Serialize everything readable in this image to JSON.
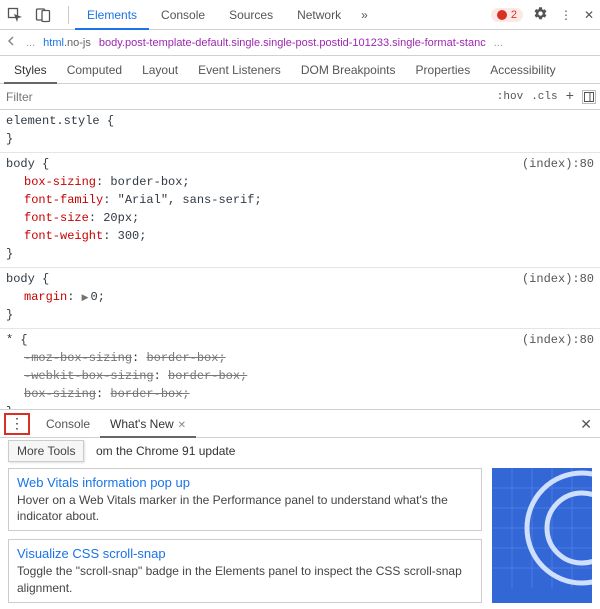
{
  "toolbar": {
    "tabs": [
      "Elements",
      "Console",
      "Sources",
      "Network"
    ],
    "active_tab": "Elements",
    "error_count": "2"
  },
  "breadcrumb": {
    "html_tag": "html",
    "html_class": ".no-js",
    "body_tag": "body",
    "body_class": ".post-template-default.single.single-post.postid-101233.single-format-stanc",
    "trailing": "..."
  },
  "sub_tabs": [
    "Styles",
    "Computed",
    "Layout",
    "Event Listeners",
    "DOM Breakpoints",
    "Properties",
    "Accessibility"
  ],
  "active_sub_tab": "Styles",
  "filter": {
    "placeholder": "Filter",
    "hov": ":hov",
    "cls": ".cls"
  },
  "rules": [
    {
      "selector": "element.style",
      "source": "",
      "decls": []
    },
    {
      "selector": "body",
      "source": "(index):80",
      "decls": [
        {
          "prop": "box-sizing",
          "val": "border-box;"
        },
        {
          "prop": "font-family",
          "val": "\"Arial\", sans-serif;"
        },
        {
          "prop": "font-size",
          "val": "20px;"
        },
        {
          "prop": "font-weight",
          "val": "300;"
        }
      ]
    },
    {
      "selector": "body",
      "source": "(index):80",
      "decls": [
        {
          "prop": "margin",
          "val": "0;",
          "expand": true
        }
      ]
    },
    {
      "selector": "*",
      "source": "(index):80",
      "decls": [
        {
          "prop": "-moz-box-sizing",
          "val": "border-box;",
          "struck": true
        },
        {
          "prop": "-webkit-box-sizing",
          "val": "border-box;",
          "struck": true
        },
        {
          "prop": "box-sizing",
          "val": "border-box;",
          "struck": true
        }
      ]
    }
  ],
  "drawer": {
    "tabs": [
      "Console",
      "What's New"
    ],
    "active_tab": "What's New",
    "more_tools": "More Tools",
    "header": "om the Chrome 91 update",
    "cards": [
      {
        "title": "Web Vitals information pop up",
        "desc": "Hover on a Web Vitals marker in the Performance panel to understand what's the indicator about."
      },
      {
        "title": "Visualize CSS scroll-snap",
        "desc": "Toggle the \"scroll-snap\" badge in the Elements panel to inspect the CSS scroll-snap alignment."
      }
    ]
  }
}
